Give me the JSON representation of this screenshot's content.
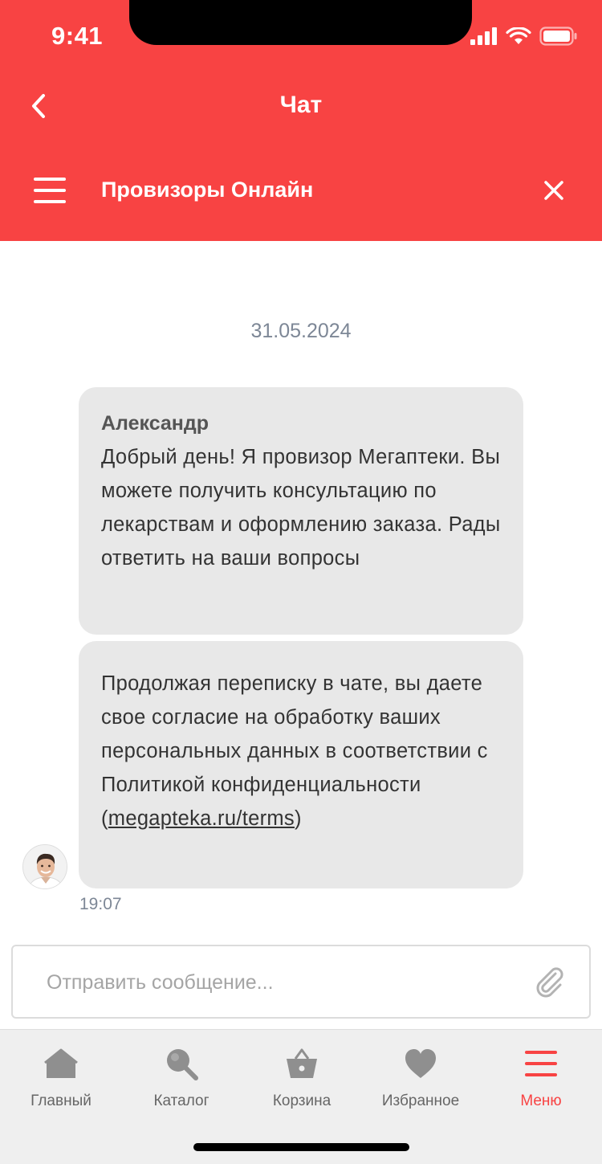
{
  "status_bar": {
    "time": "9:41"
  },
  "header": {
    "title": "Чат",
    "chat_name": "Провизоры Онлайн"
  },
  "chat": {
    "date": "31.05.2024",
    "messages": [
      {
        "sender": "Александр",
        "text": "Добрый день! Я провизор Мегаптеки. Вы можете получить консультацию по лекарствам и оформлению заказа. Рады ответить на ваши вопросы"
      },
      {
        "text_before_link": "Продолжая переписку в чате, вы даете свое согласие на обработку ваших персональных данных в соответствии с Политикой конфиденциальности (",
        "link_text": "megapteka.ru/terms",
        "text_after_link": ")"
      }
    ],
    "time": "19:07"
  },
  "composer": {
    "placeholder": "Отправить сообщение..."
  },
  "nav": {
    "items": [
      {
        "label": "Главный",
        "icon": "home-icon"
      },
      {
        "label": "Каталог",
        "icon": "search-icon"
      },
      {
        "label": "Корзина",
        "icon": "basket-icon"
      },
      {
        "label": "Избранное",
        "icon": "heart-icon"
      },
      {
        "label": "Меню",
        "icon": "menu-icon",
        "active": true
      }
    ]
  },
  "colors": {
    "accent": "#f84343",
    "bubble": "#e8e8e8",
    "muted": "#7d8796",
    "nav_bg": "#efefef"
  }
}
